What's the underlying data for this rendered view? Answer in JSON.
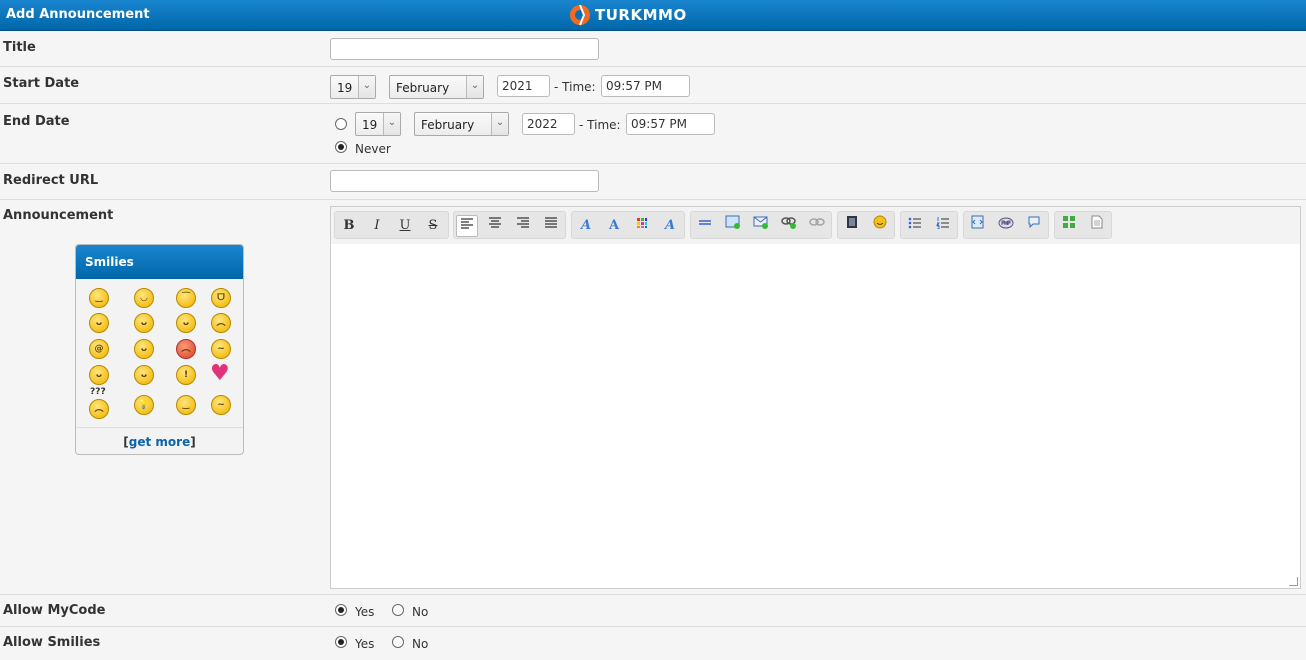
{
  "header": {
    "title": "Add Announcement",
    "logo_text": "TURKMMO"
  },
  "form": {
    "title": {
      "label": "Title",
      "value": ""
    },
    "start_date": {
      "label": "Start Date",
      "day": "19",
      "month": "February",
      "year": "2021",
      "time_label": "- Time:",
      "time": "09:57 PM"
    },
    "end_date": {
      "label": "End Date",
      "day": "19",
      "month": "February",
      "year": "2022",
      "time_label": "- Time:",
      "time": "09:57 PM",
      "never_label": "Never",
      "selected": "never"
    },
    "redirect_url": {
      "label": "Redirect URL",
      "value": ""
    },
    "announcement": {
      "label": "Announcement",
      "value": ""
    },
    "allow_mycode": {
      "label": "Allow MyCode",
      "yes": "Yes",
      "no": "No",
      "selected": "yes"
    },
    "allow_smilies": {
      "label": "Allow Smilies",
      "yes": "Yes",
      "no": "No",
      "selected": "yes"
    }
  },
  "toolbar": {
    "bold": "B",
    "italic": "I",
    "underline": "U",
    "strike": "S",
    "icons": [
      "align-left-icon",
      "align-center-icon",
      "align-right-icon",
      "align-justify-icon",
      "font-icon",
      "font-size-icon",
      "color-icon",
      "remove-format-icon",
      "horizontal-rule-icon",
      "image-icon",
      "email-icon",
      "link-icon",
      "unlink-icon",
      "video-icon",
      "emoticon-icon",
      "bullet-list-icon",
      "numbered-list-icon",
      "code-icon",
      "php-icon",
      "quote-icon",
      "maximize-icon",
      "source-icon"
    ]
  },
  "smilies": {
    "title": "Smilies",
    "get_more_prefix": "[",
    "get_more": "get more",
    "get_more_suffix": "]",
    "faces": [
      "smile",
      "big-grin",
      "cool",
      "grin",
      "tongue",
      "rolleyes",
      "shy",
      "sad",
      "at",
      "huh",
      "angry",
      "confused",
      "sleepy",
      "blush",
      "exclamation",
      "heart",
      "question",
      "idea",
      "wink",
      "undecided"
    ],
    "at_symbol": "@",
    "exclamation_symbol": "!",
    "question_symbol": "???"
  }
}
